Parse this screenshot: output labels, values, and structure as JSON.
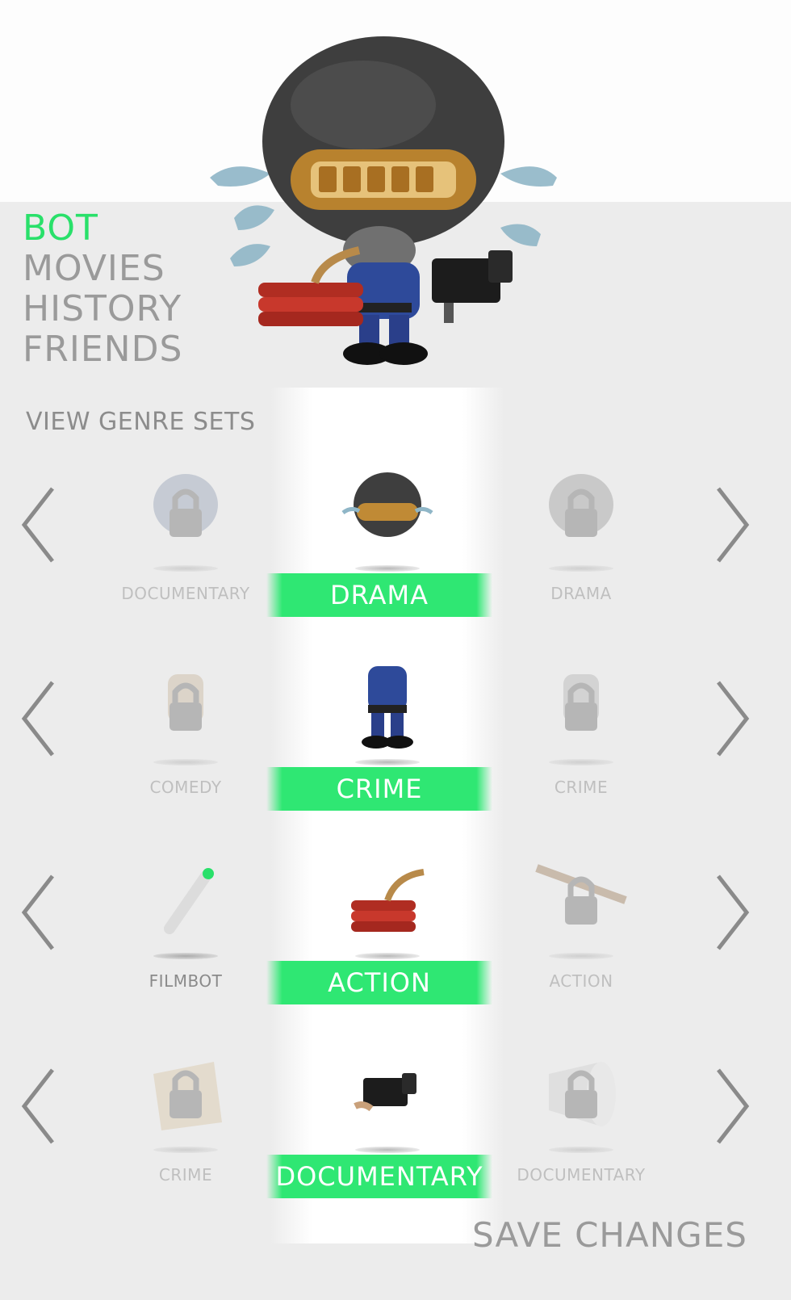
{
  "nav": {
    "items": [
      "BOT",
      "MOVIES",
      "HISTORY",
      "FRIENDS"
    ],
    "active": "BOT"
  },
  "section_title": "VIEW GENRE SETS",
  "rows": [
    {
      "left_label": "DOCUMENTARY",
      "center_label": "DRAMA",
      "right_label": "DRAMA",
      "left_icon": "locked-helmet-icon",
      "center_icon": "crying-helmet-icon",
      "right_icon": "locked-helmet-icon"
    },
    {
      "left_label": "COMEDY",
      "center_label": "CRIME",
      "right_label": "CRIME",
      "left_icon": "locked-body-icon",
      "center_icon": "police-body-icon",
      "right_icon": "locked-body-icon"
    },
    {
      "left_label": "FILMBOT",
      "center_label": "ACTION",
      "right_label": "ACTION",
      "left_icon": "laser-pointer-icon",
      "center_icon": "dynamite-icon",
      "right_icon": "locked-tommy-gun-icon"
    },
    {
      "left_label": "CRIME",
      "center_label": "DOCUMENTARY",
      "right_label": "DOCUMENTARY",
      "left_icon": "locked-bag-icon",
      "center_icon": "video-camera-icon",
      "right_icon": "locked-megaphone-icon"
    }
  ],
  "save_label": "SAVE CHANGES",
  "colors": {
    "accent": "#2fe773",
    "text_muted": "#9a9a9a",
    "panel_bg": "#ececec"
  }
}
